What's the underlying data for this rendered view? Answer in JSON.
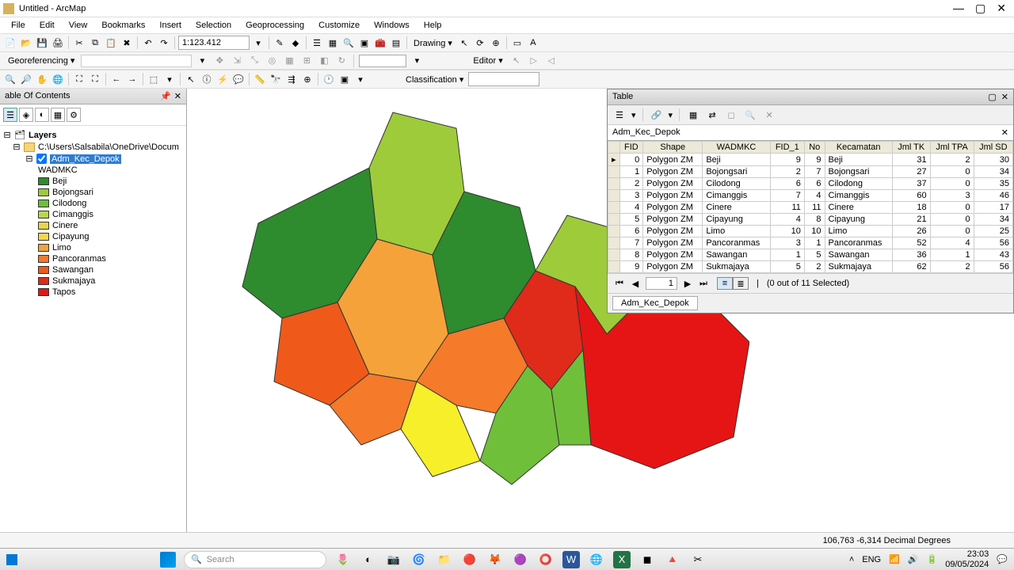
{
  "window": {
    "title": "Untitled - ArcMap"
  },
  "menu": [
    "File",
    "Edit",
    "View",
    "Bookmarks",
    "Insert",
    "Selection",
    "Geoprocessing",
    "Customize",
    "Windows",
    "Help"
  ],
  "scale": "1:123.412",
  "drawing_label": "Drawing ▾",
  "editor_label": "Editor ▾",
  "georef_label": "Georeferencing ▾",
  "classification_label": "Classification ▾",
  "toc": {
    "title": "able Of Contents",
    "layers_label": "Layers",
    "path": "C:\\Users\\Salsabila\\OneDrive\\Docum",
    "layer": "Adm_Kec_Depok",
    "field": "WADMKC",
    "items": [
      {
        "label": "Beji",
        "color": "#2e8b2e"
      },
      {
        "label": "Bojongsari",
        "color": "#9ecb3a"
      },
      {
        "label": "Cilodong",
        "color": "#6fbf3a"
      },
      {
        "label": "Cimanggis",
        "color": "#b9d84a"
      },
      {
        "label": "Cinere",
        "color": "#e8d54a"
      },
      {
        "label": "Cipayung",
        "color": "#f5d84a"
      },
      {
        "label": "Limo",
        "color": "#f5a23a"
      },
      {
        "label": "Pancoranmas",
        "color": "#f57a2a"
      },
      {
        "label": "Sawangan",
        "color": "#ef5a1a"
      },
      {
        "label": "Sukmajaya",
        "color": "#e02a1a"
      },
      {
        "label": "Tapos",
        "color": "#e51515"
      }
    ]
  },
  "table": {
    "panel_title": "Table",
    "layer_name": "Adm_Kec_Depok",
    "columns": [
      "FID",
      "Shape",
      "WADMKC",
      "FID_1",
      "No",
      "Kecamatan",
      "Jml TK",
      "Jml TPA",
      "Jml SD"
    ],
    "rows": [
      [
        0,
        "Polygon ZM",
        "Beji",
        9,
        9,
        "Beji",
        31,
        2,
        30
      ],
      [
        1,
        "Polygon ZM",
        "Bojongsari",
        2,
        7,
        "Bojongsari",
        27,
        0,
        34
      ],
      [
        2,
        "Polygon ZM",
        "Cilodong",
        6,
        6,
        "Cilodong",
        37,
        0,
        35
      ],
      [
        3,
        "Polygon ZM",
        "Cimanggis",
        7,
        4,
        "Cimanggis",
        60,
        3,
        46
      ],
      [
        4,
        "Polygon ZM",
        "Cinere",
        11,
        11,
        "Cinere",
        18,
        0,
        17
      ],
      [
        5,
        "Polygon ZM",
        "Cipayung",
        4,
        8,
        "Cipayung",
        21,
        0,
        34
      ],
      [
        6,
        "Polygon ZM",
        "Limo",
        10,
        10,
        "Limo",
        26,
        0,
        25
      ],
      [
        7,
        "Polygon ZM",
        "Pancoranmas",
        3,
        1,
        "Pancoranmas",
        52,
        4,
        56
      ],
      [
        8,
        "Polygon ZM",
        "Sawangan",
        1,
        5,
        "Sawangan",
        36,
        1,
        43
      ],
      [
        9,
        "Polygon ZM",
        "Sukmajaya",
        5,
        2,
        "Sukmajaya",
        62,
        2,
        56
      ]
    ],
    "page": "1",
    "selection": "(0 out of 11 Selected)",
    "tab": "Adm_Kec_Depok"
  },
  "status": {
    "coords": "106,763  -6,314 Decimal Degrees"
  },
  "taskbar": {
    "search_placeholder": "Search",
    "lang": "ENG",
    "time": "23:03",
    "date": "09/05/2024"
  }
}
